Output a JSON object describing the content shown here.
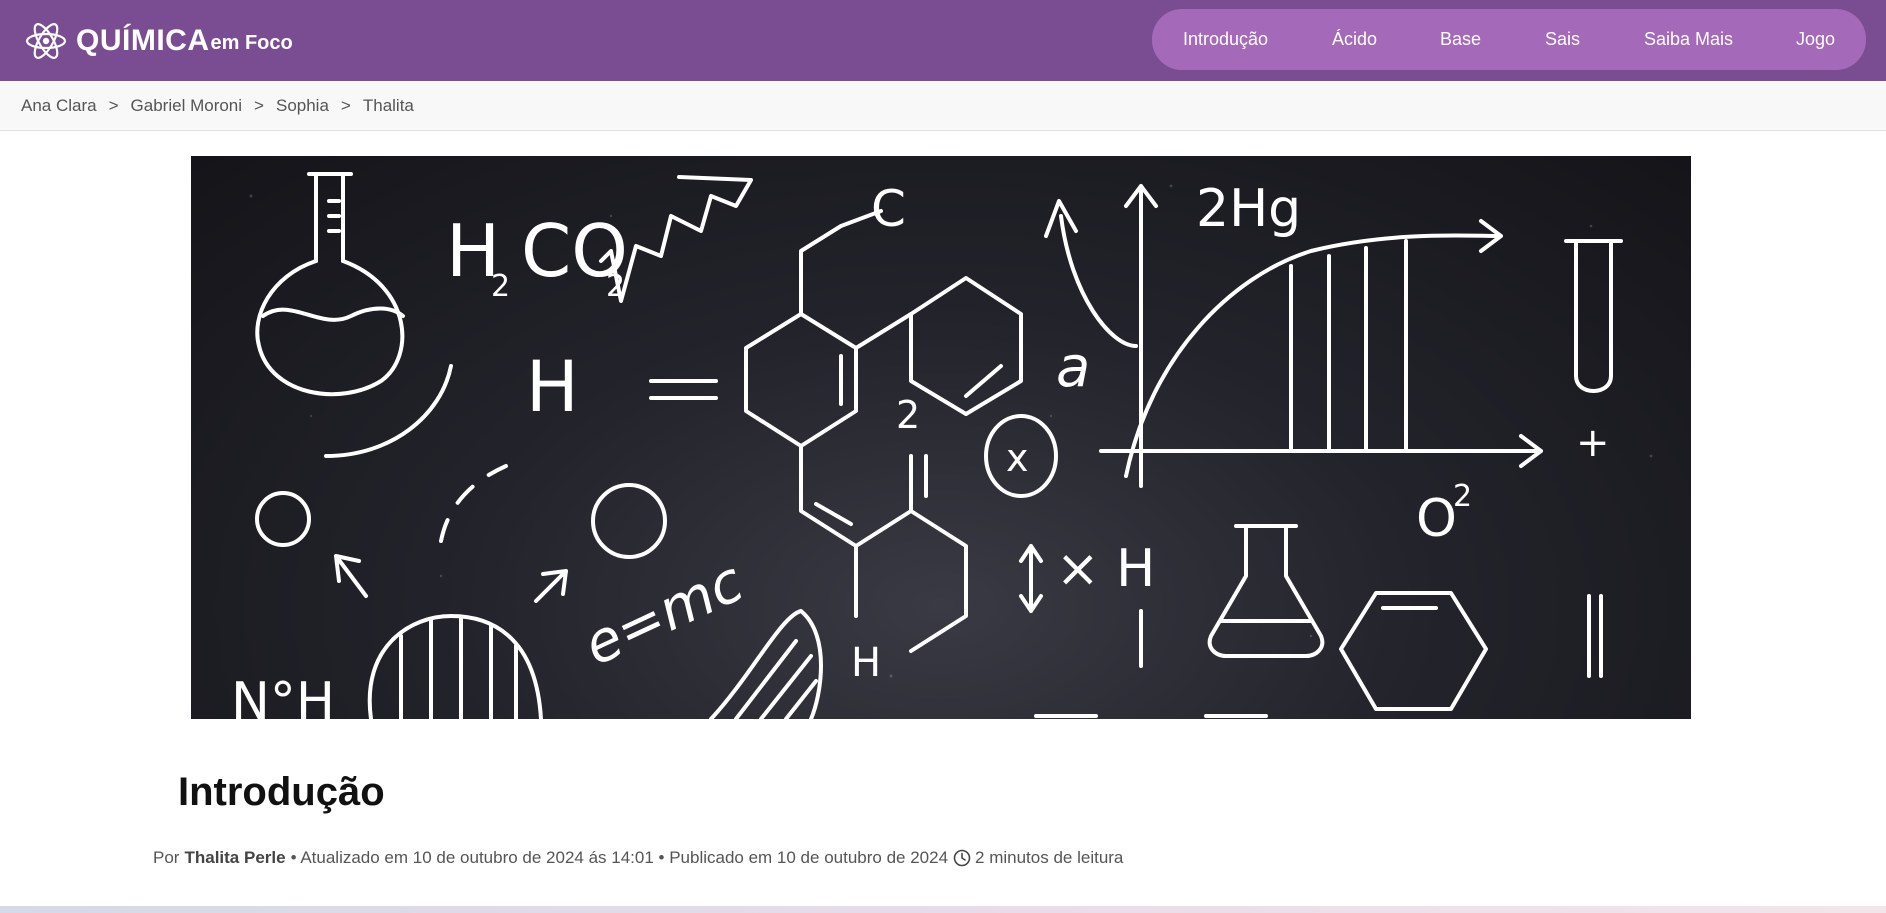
{
  "header": {
    "logo_main": "QUÍMICA",
    "logo_sub": "em Foco",
    "nav": [
      {
        "label": "Introdução"
      },
      {
        "label": "Ácido"
      },
      {
        "label": "Base"
      },
      {
        "label": "Sais"
      },
      {
        "label": "Saiba Mais"
      },
      {
        "label": "Jogo"
      }
    ]
  },
  "breadcrumb": {
    "separator": ">",
    "items": [
      "Ana Clara",
      "Gabriel Moroni",
      "Sophia",
      "Thalita"
    ]
  },
  "hero": {
    "formula_h2co2": "H",
    "formula_sub2": "2",
    "formula_co": "CO",
    "formula_sub2b": "2",
    "formula_h": "H",
    "formula_2hg": "2Hg",
    "formula_a": "a",
    "formula_2": "2",
    "formula_x": "x",
    "formula_o2": "O",
    "formula_o2_sup": "2",
    "formula_emc": "e=mc",
    "formula_noh": "N°H",
    "formula_h_bottom": "H",
    "formula_c_chain": "C",
    "formula_plus": "+",
    "formula_xh": "× H"
  },
  "article": {
    "title": "Introdução",
    "by": "Por",
    "author": "Thalita Perle",
    "updated": "• Atualizado em 10 de outubro de 2024 ás 14:01 • Publicado em 10 de outubro de 2024",
    "read_time": "2 minutos de leitura"
  },
  "colors": {
    "header": "#7a4d92",
    "nav_pill": "#a46ab9",
    "breadcrumb_bg": "#f8f8f8"
  }
}
